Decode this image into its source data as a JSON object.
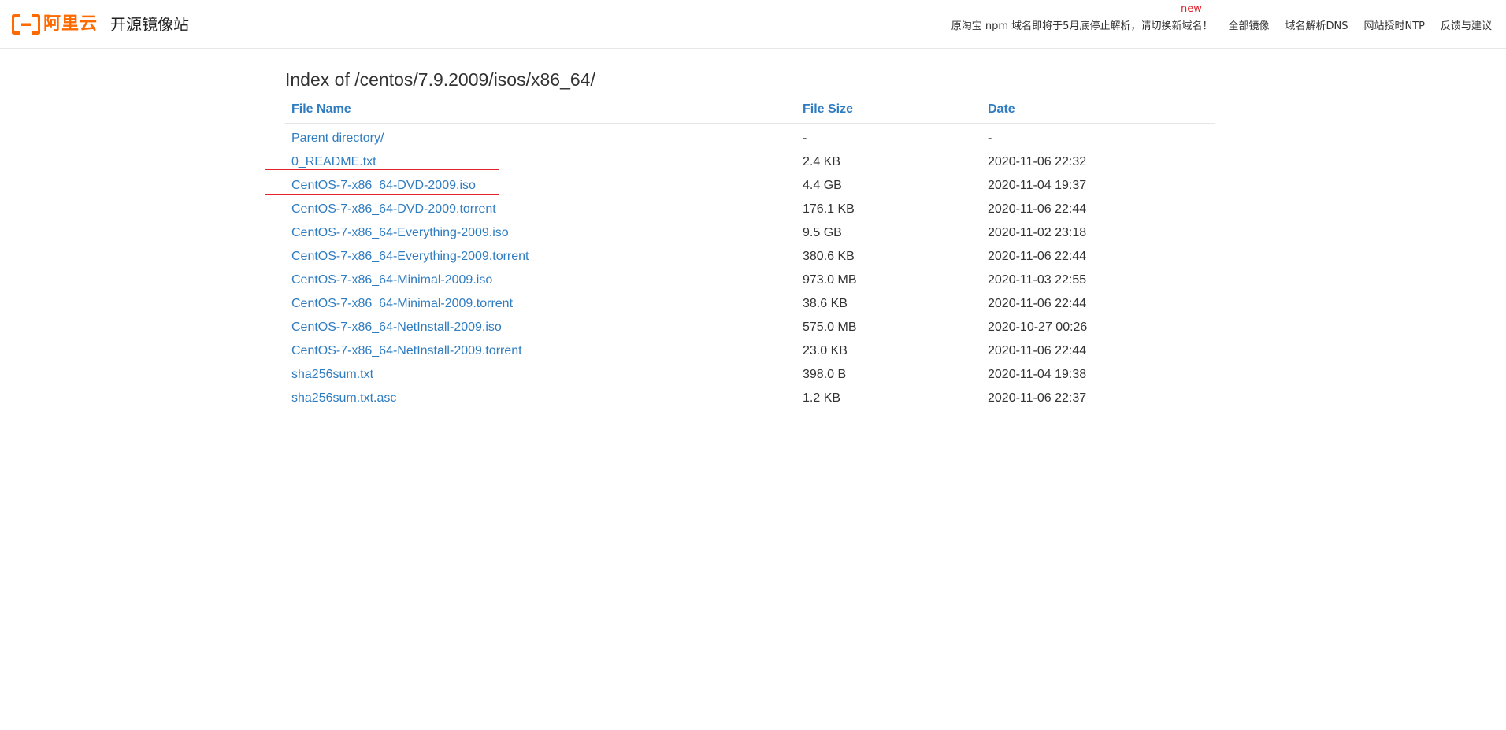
{
  "header": {
    "brand_name": "阿里云",
    "site_title": "开源镜像站",
    "brand_color": "#ff6a00",
    "nav": [
      {
        "label": "原淘宝 npm 域名即将于5月底停止解析，请切换新域名！"
      },
      {
        "label": "全部镜像"
      },
      {
        "label": "域名解析DNS"
      },
      {
        "label": "网站授时NTP"
      },
      {
        "label": "反馈与建议"
      }
    ],
    "new_badge": "new"
  },
  "listing": {
    "title": "Index of /centos/7.9.2009/isos/x86_64/",
    "columns": {
      "name": "File Name",
      "size": "File Size",
      "date": "Date"
    },
    "rows": [
      {
        "name": "Parent directory/",
        "size": "-",
        "date": "-"
      },
      {
        "name": "0_README.txt",
        "size": "2.4 KB",
        "date": "2020-11-06 22:32"
      },
      {
        "name": "CentOS-7-x86_64-DVD-2009.iso",
        "size": "4.4 GB",
        "date": "2020-11-04 19:37"
      },
      {
        "name": "CentOS-7-x86_64-DVD-2009.torrent",
        "size": "176.1 KB",
        "date": "2020-11-06 22:44"
      },
      {
        "name": "CentOS-7-x86_64-Everything-2009.iso",
        "size": "9.5 GB",
        "date": "2020-11-02 23:18"
      },
      {
        "name": "CentOS-7-x86_64-Everything-2009.torrent",
        "size": "380.6 KB",
        "date": "2020-11-06 22:44"
      },
      {
        "name": "CentOS-7-x86_64-Minimal-2009.iso",
        "size": "973.0 MB",
        "date": "2020-11-03 22:55"
      },
      {
        "name": "CentOS-7-x86_64-Minimal-2009.torrent",
        "size": "38.6 KB",
        "date": "2020-11-06 22:44"
      },
      {
        "name": "CentOS-7-x86_64-NetInstall-2009.iso",
        "size": "575.0 MB",
        "date": "2020-10-27 00:26"
      },
      {
        "name": "CentOS-7-x86_64-NetInstall-2009.torrent",
        "size": "23.0 KB",
        "date": "2020-11-06 22:44"
      },
      {
        "name": "sha256sum.txt",
        "size": "398.0 B",
        "date": "2020-11-04 19:38"
      },
      {
        "name": "sha256sum.txt.asc",
        "size": "1.2 KB",
        "date": "2020-11-06 22:37"
      }
    ]
  },
  "colors": {
    "link": "#2f7cc0",
    "highlight": "#e3222a",
    "badge": "#e3222a"
  }
}
